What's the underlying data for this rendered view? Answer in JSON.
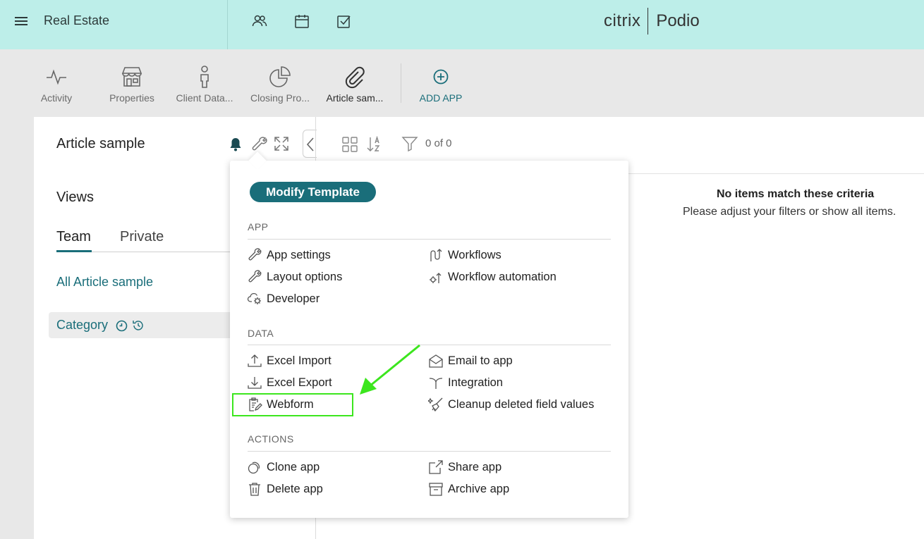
{
  "topbar": {
    "workspace_name": "Real Estate",
    "brand_left": "citrix",
    "brand_right": "Podio",
    "icons": [
      "menu-icon",
      "contacts-icon",
      "calendar-icon",
      "tasks-icon"
    ]
  },
  "apps": [
    {
      "label": "Activity",
      "icon": "activity-icon"
    },
    {
      "label": "Properties",
      "icon": "storefront-icon"
    },
    {
      "label": "Client Data...",
      "icon": "person-icon"
    },
    {
      "label": "Closing Pro...",
      "icon": "pie-chart-icon"
    },
    {
      "label": "Article sam...",
      "icon": "paperclip-icon"
    },
    {
      "label": "ADD APP",
      "icon": "plus-circle-icon"
    }
  ],
  "panel": {
    "title": "Article sample",
    "views_title": "Views",
    "tabs": [
      "Team",
      "Private"
    ],
    "all_link": "All Article sample",
    "category_label": "Category"
  },
  "view_toolbar": {
    "count": "0 of 0"
  },
  "empty_state": {
    "title": "No items match these criteria",
    "subtitle": "Please adjust your filters or show all items."
  },
  "dropdown": {
    "modify_button": "Modify Template",
    "sections": [
      {
        "heading": "APP",
        "left": [
          "App settings",
          "Layout options",
          "Developer"
        ],
        "right": [
          "Workflows",
          "Workflow automation"
        ]
      },
      {
        "heading": "DATA",
        "left": [
          "Excel Import",
          "Excel Export",
          "Webform"
        ],
        "right": [
          "Email to app",
          "Integration",
          "Cleanup deleted field values"
        ]
      },
      {
        "heading": "ACTIONS",
        "left": [
          "Clone app",
          "Delete app"
        ],
        "right": [
          "Share app",
          "Archive app"
        ]
      }
    ]
  },
  "colors": {
    "topbar_bg": "#bdeee9",
    "accent": "#1a6e7a",
    "highlight": "#3ce61e"
  }
}
